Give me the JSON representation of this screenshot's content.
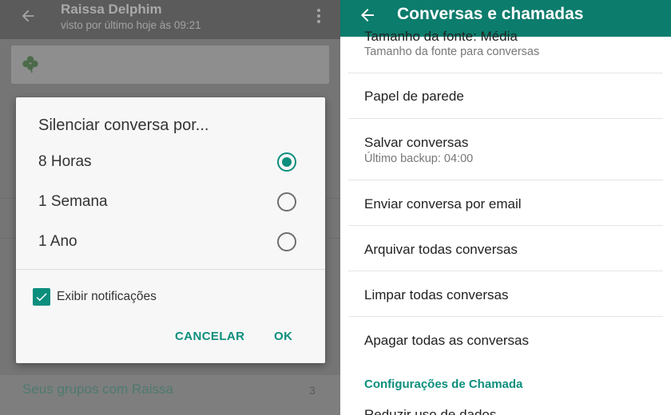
{
  "chat": {
    "contact_name": "Raissa Delphim",
    "last_seen": "visto por último hoje às 09:21",
    "groups_label": "Seus grupos com Raissa",
    "groups_count": "3"
  },
  "mute_dialog": {
    "title": "Silenciar conversa por...",
    "options": [
      {
        "label": "8 Horas",
        "selected": true
      },
      {
        "label": "1 Semana",
        "selected": false
      },
      {
        "label": "1 Ano",
        "selected": false
      }
    ],
    "show_notifications_label": "Exibir notificações",
    "show_notifications_checked": true,
    "cancel_label": "CANCELAR",
    "ok_label": "OK"
  },
  "settings": {
    "title": "Conversas e chamadas",
    "items": [
      {
        "title": "Tamanho da fonte: Média",
        "subtitle": "Tamanho da fonte para conversas"
      },
      {
        "title": "Papel de parede",
        "subtitle": ""
      },
      {
        "title": "Salvar conversas",
        "subtitle": "Último backup: 04:00"
      },
      {
        "title": "Enviar conversa por email",
        "subtitle": ""
      },
      {
        "title": "Arquivar todas conversas",
        "subtitle": ""
      },
      {
        "title": "Limpar todas conversas",
        "subtitle": ""
      },
      {
        "title": "Apagar todas as conversas",
        "subtitle": ""
      }
    ],
    "section_header": "Configurações de Chamada",
    "cut_item": "Reduzir uso de dados"
  },
  "colors": {
    "accent": "#0c8e7d",
    "appbar_green": "#0c7c6c"
  },
  "icons": [
    "back-arrow-icon",
    "overflow-menu-icon",
    "clover-emoji-icon",
    "checkmark-icon"
  ]
}
